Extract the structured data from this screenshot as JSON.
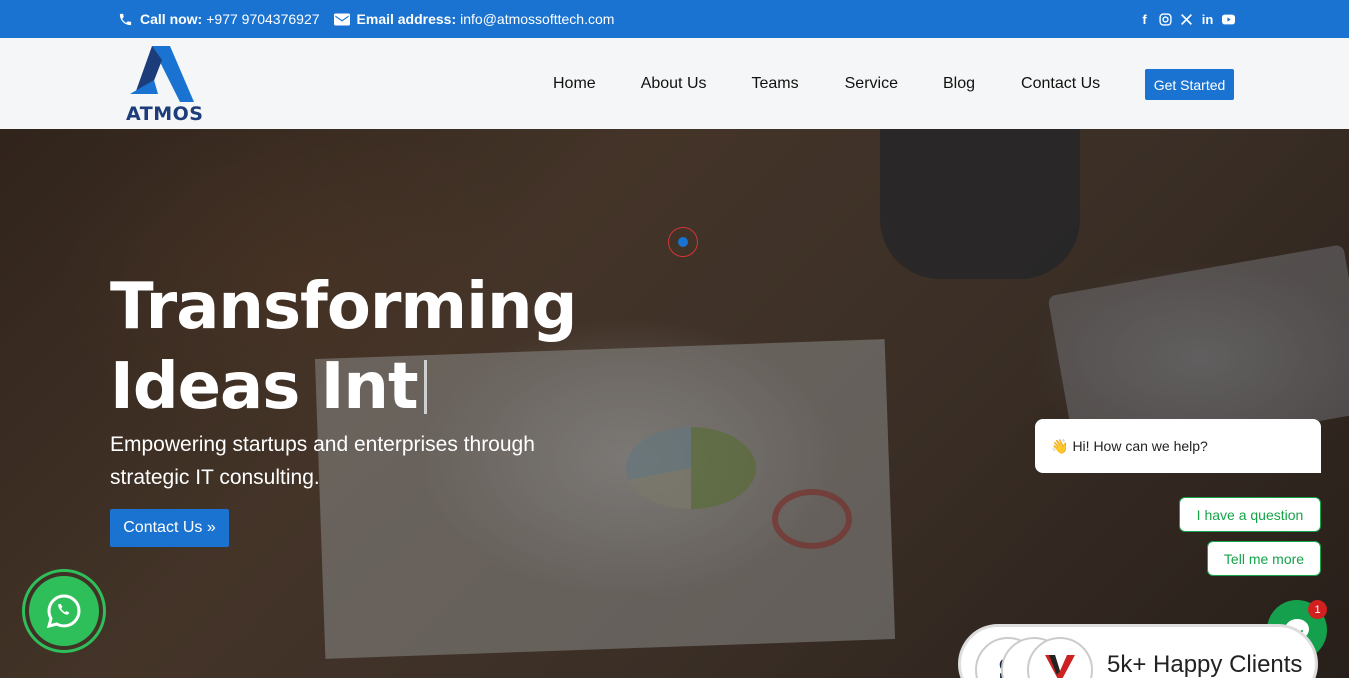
{
  "topbar": {
    "call_label": "Call now:",
    "call_value": "+977 9704376927",
    "email_label": "Email address:",
    "email_value": "info@atmossofttech.com",
    "social": [
      "facebook-icon",
      "instagram-icon",
      "x-icon",
      "linkedin-icon",
      "youtube-icon"
    ]
  },
  "header": {
    "logo_text": "ATMOS",
    "nav": [
      "Home",
      "About Us",
      "Teams",
      "Service",
      "Blog",
      "Contact Us"
    ],
    "cta": "Get Started"
  },
  "hero": {
    "title_line1": "Transforming",
    "title_line2": "Ideas Int",
    "subtitle": "Empowering startups and enterprises through strategic IT consulting.",
    "button": "Contact Us »"
  },
  "chat": {
    "greeting_emoji": "👋",
    "greeting": "Hi! How can we help?",
    "options": [
      "I have a question",
      "Tell me more"
    ],
    "badge": "1"
  },
  "clients": {
    "label": "5k+ Happy Clients"
  },
  "colors": {
    "brand_blue": "#1a73d1",
    "chat_green": "#15a34a"
  }
}
